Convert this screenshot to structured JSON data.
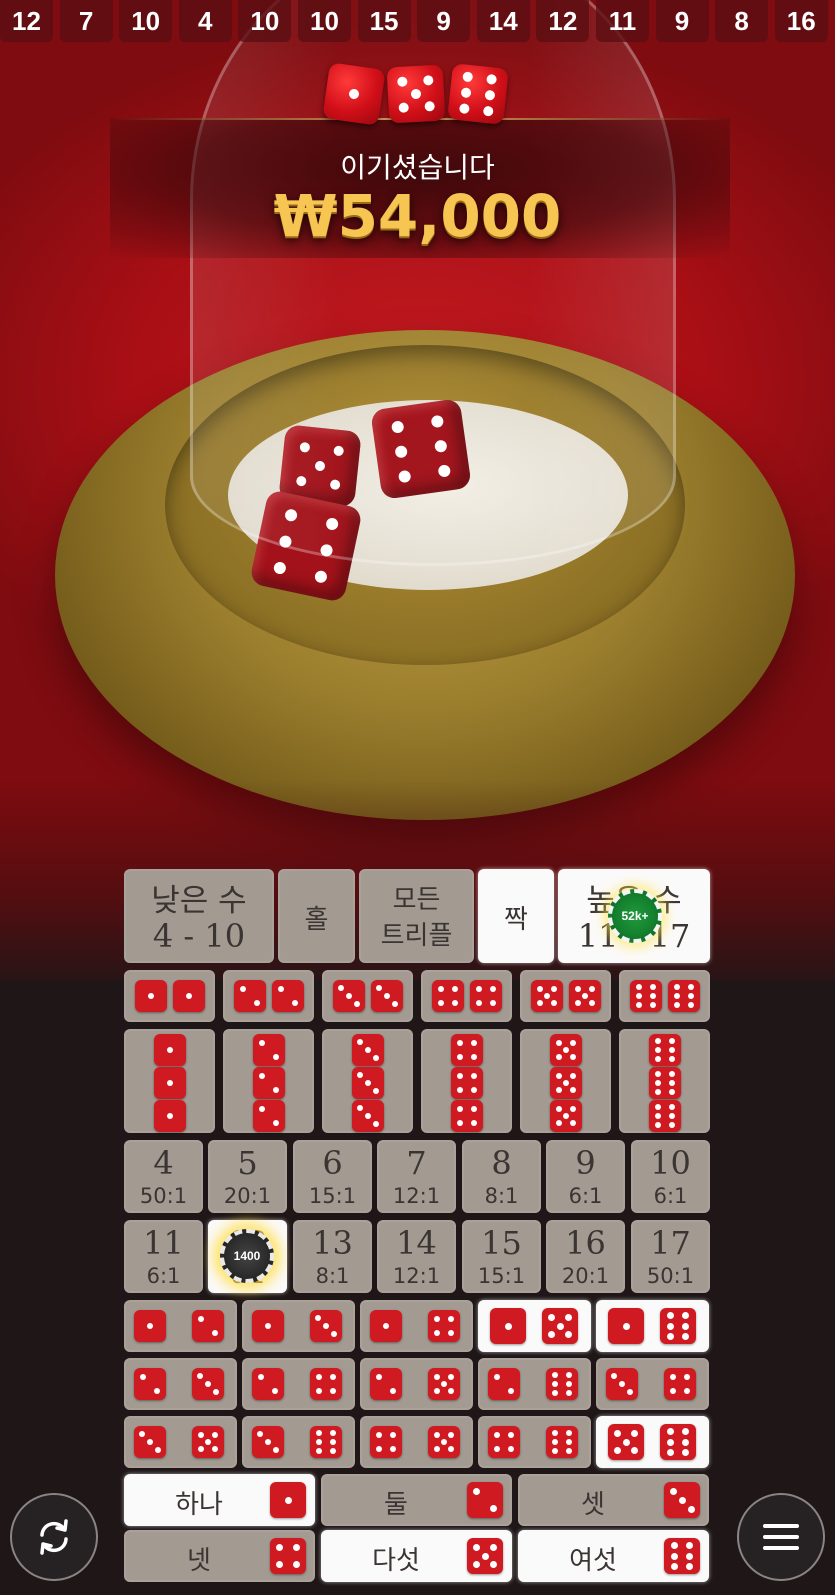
{
  "history": [
    "12",
    "7",
    "10",
    "4",
    "10",
    "10",
    "15",
    "9",
    "14",
    "12",
    "11",
    "9",
    "8",
    "16"
  ],
  "result": {
    "dice": [
      1,
      5,
      6
    ],
    "label": "이기셨습니다",
    "amount": "₩54,000"
  },
  "table_dice": [
    5,
    6,
    6
  ],
  "board": {
    "top": [
      {
        "line1": "낮은 수",
        "line2": "4 - 10",
        "highlight": false
      },
      {
        "line1": "홀",
        "highlight": false
      },
      {
        "line1": "모든",
        "line2": "트리플",
        "highlight": false
      },
      {
        "line1": "짝",
        "highlight": true
      },
      {
        "line1": "높은 수",
        "line2": "11 - 17",
        "highlight": true,
        "chip": "52k+"
      }
    ],
    "doubles": [
      1,
      2,
      3,
      4,
      5,
      6
    ],
    "triples": [
      1,
      2,
      3,
      4,
      5,
      6
    ],
    "totals_row1": [
      {
        "num": "4",
        "odds": "50:1"
      },
      {
        "num": "5",
        "odds": "20:1"
      },
      {
        "num": "6",
        "odds": "15:1"
      },
      {
        "num": "7",
        "odds": "12:1"
      },
      {
        "num": "8",
        "odds": "8:1"
      },
      {
        "num": "9",
        "odds": "6:1"
      },
      {
        "num": "10",
        "odds": "6:1"
      }
    ],
    "totals_row2": [
      {
        "num": "11",
        "odds": "6:1"
      },
      {
        "num": "12",
        "odds": "6:1",
        "highlight": true,
        "chip": "1400"
      },
      {
        "num": "13",
        "odds": "8:1"
      },
      {
        "num": "14",
        "odds": "12:1"
      },
      {
        "num": "15",
        "odds": "15:1"
      },
      {
        "num": "16",
        "odds": "20:1"
      },
      {
        "num": "17",
        "odds": "50:1"
      }
    ],
    "combos": [
      [
        [
          1,
          2
        ],
        [
          1,
          3
        ],
        [
          1,
          4
        ],
        [
          1,
          5
        ],
        [
          1,
          6
        ]
      ],
      [
        [
          2,
          3
        ],
        [
          2,
          4
        ],
        [
          2,
          5
        ],
        [
          2,
          6
        ],
        [
          3,
          4
        ]
      ],
      [
        [
          3,
          5
        ],
        [
          3,
          6
        ],
        [
          4,
          5
        ],
        [
          4,
          6
        ],
        [
          5,
          6
        ]
      ]
    ],
    "combo_highlights": [
      [
        1,
        5
      ],
      [
        1,
        6
      ],
      [
        5,
        6
      ]
    ],
    "singles": [
      {
        "label": "하나",
        "face": 1,
        "highlight": true
      },
      {
        "label": "둘",
        "face": 2,
        "highlight": false
      },
      {
        "label": "셋",
        "face": 3,
        "highlight": false
      },
      {
        "label": "넷",
        "face": 4,
        "highlight": false
      },
      {
        "label": "다섯",
        "face": 5,
        "highlight": true
      },
      {
        "label": "여섯",
        "face": 6,
        "highlight": true
      }
    ]
  },
  "controls": {
    "repeat_icon": "repeat-icon",
    "menu_icon": "menu-icon"
  },
  "colors": {
    "felt": "#b3121a",
    "die_red": "#cf1a22",
    "cell_grey": "#a39b92",
    "cell_highlight": "#fbfafa",
    "win_gold": "#f7c552"
  }
}
